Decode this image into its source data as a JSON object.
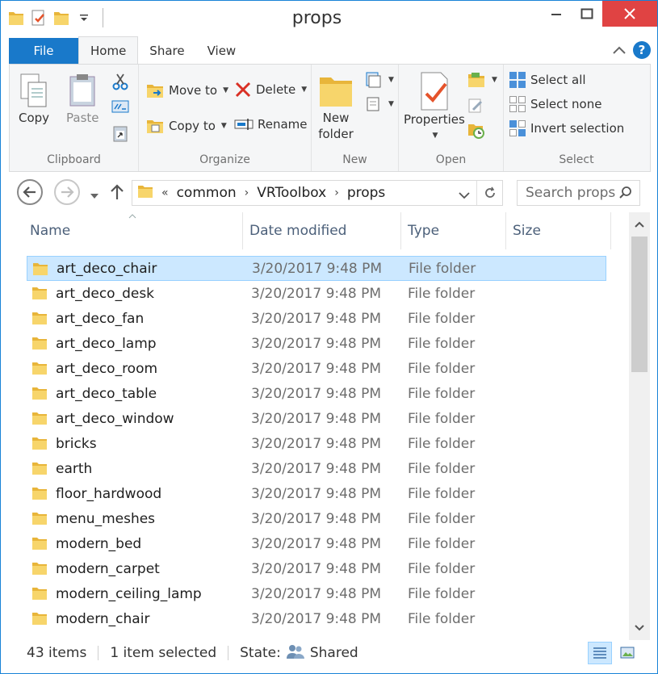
{
  "window": {
    "title": "props"
  },
  "tabs": [
    {
      "label": "File"
    },
    {
      "label": "Home"
    },
    {
      "label": "Share"
    },
    {
      "label": "View"
    }
  ],
  "ribbon": {
    "clipboard": {
      "label": "Clipboard",
      "copy": "Copy",
      "paste": "Paste"
    },
    "organize": {
      "label": "Organize",
      "move_to": "Move to",
      "copy_to": "Copy to",
      "delete": "Delete",
      "rename": "Rename"
    },
    "new": {
      "label": "New",
      "new_folder_l1": "New",
      "new_folder_l2": "folder"
    },
    "open": {
      "label": "Open",
      "properties": "Properties"
    },
    "select": {
      "label": "Select",
      "select_all": "Select all",
      "select_none": "Select none",
      "invert": "Invert selection"
    }
  },
  "address": {
    "overflow": "«",
    "crumbs": [
      "common",
      "VRToolbox",
      "props"
    ],
    "search_placeholder": "Search props"
  },
  "columns": {
    "name": "Name",
    "date": "Date modified",
    "type": "Type",
    "size": "Size"
  },
  "files": [
    {
      "name": "art_deco_chair",
      "date": "3/20/2017 9:48 PM",
      "type": "File folder"
    },
    {
      "name": "art_deco_desk",
      "date": "3/20/2017 9:48 PM",
      "type": "File folder"
    },
    {
      "name": "art_deco_fan",
      "date": "3/20/2017 9:48 PM",
      "type": "File folder"
    },
    {
      "name": "art_deco_lamp",
      "date": "3/20/2017 9:48 PM",
      "type": "File folder"
    },
    {
      "name": "art_deco_room",
      "date": "3/20/2017 9:48 PM",
      "type": "File folder"
    },
    {
      "name": "art_deco_table",
      "date": "3/20/2017 9:48 PM",
      "type": "File folder"
    },
    {
      "name": "art_deco_window",
      "date": "3/20/2017 9:48 PM",
      "type": "File folder"
    },
    {
      "name": "bricks",
      "date": "3/20/2017 9:48 PM",
      "type": "File folder"
    },
    {
      "name": "earth",
      "date": "3/20/2017 9:48 PM",
      "type": "File folder"
    },
    {
      "name": "floor_hardwood",
      "date": "3/20/2017 9:48 PM",
      "type": "File folder"
    },
    {
      "name": "menu_meshes",
      "date": "3/20/2017 9:48 PM",
      "type": "File folder"
    },
    {
      "name": "modern_bed",
      "date": "3/20/2017 9:48 PM",
      "type": "File folder"
    },
    {
      "name": "modern_carpet",
      "date": "3/20/2017 9:48 PM",
      "type": "File folder"
    },
    {
      "name": "modern_ceiling_lamp",
      "date": "3/20/2017 9:48 PM",
      "type": "File folder"
    },
    {
      "name": "modern_chair",
      "date": "3/20/2017 9:48 PM",
      "type": "File folder"
    }
  ],
  "selected_file": "art_deco_chair",
  "status": {
    "items": "43 items",
    "selected": "1 item selected",
    "state_label": "State:",
    "state_value": "Shared"
  },
  "colors": {
    "accent": "#1979ca",
    "close": "#e04343",
    "selection": "#cce8ff",
    "folder": "#f5c542"
  }
}
